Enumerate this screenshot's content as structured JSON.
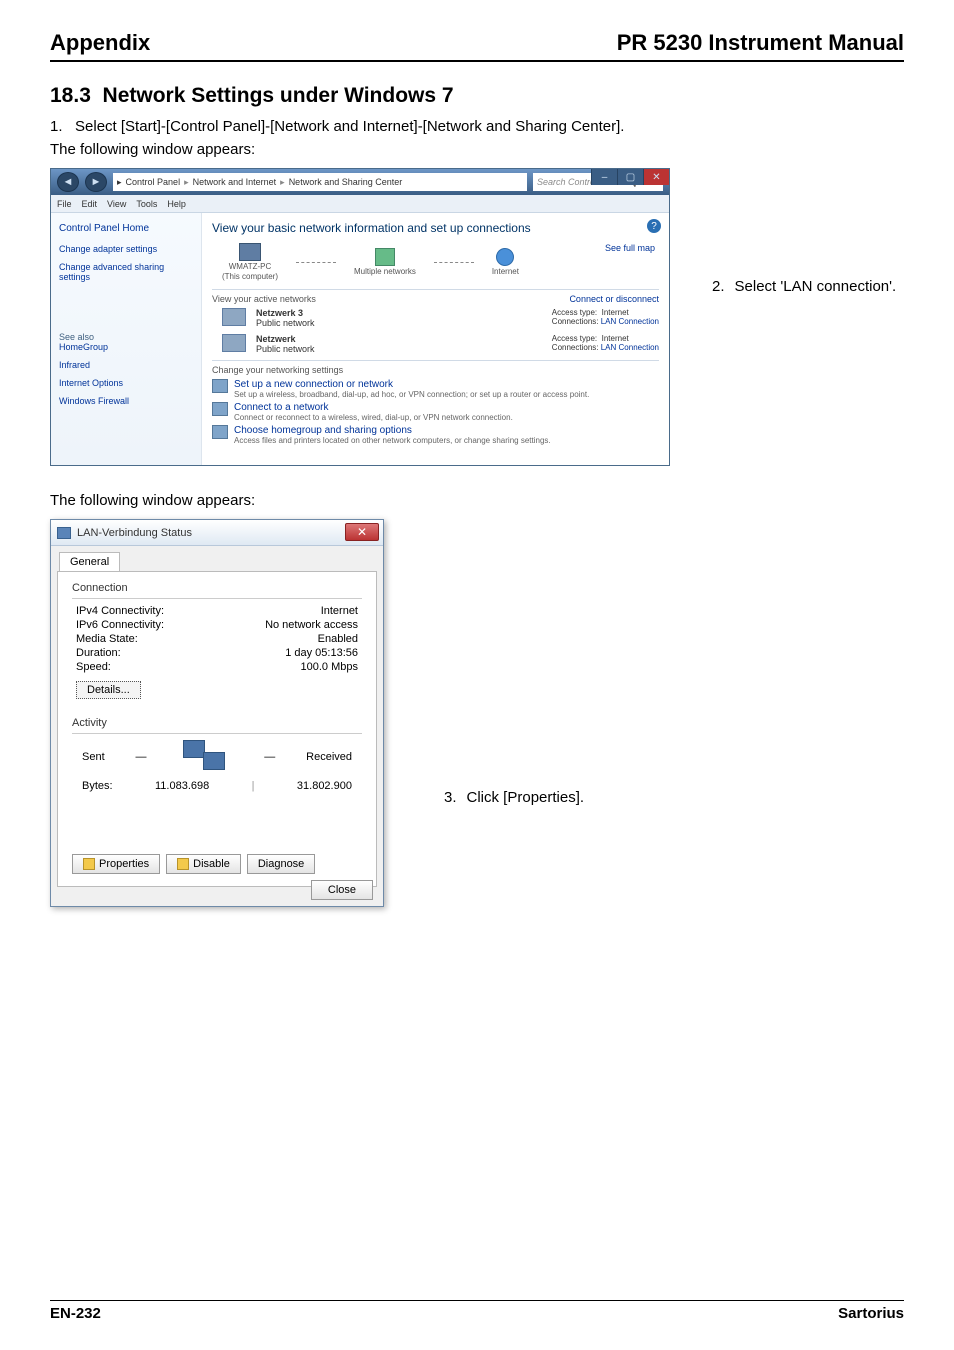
{
  "header": {
    "left": "Appendix",
    "right": "PR 5230 Instrument Manual"
  },
  "section": {
    "num": "18.3",
    "title": "Network Settings under Windows 7"
  },
  "step1": {
    "n": "1.",
    "text": "Select [Start]-[Control Panel]-[Network and Internet]-[Network and Sharing Center]."
  },
  "following": "The following window appears:",
  "sideA": {
    "n": "2.",
    "text": "Select 'LAN connection'."
  },
  "sideB": {
    "n": "3.",
    "text": "Click [Properties]."
  },
  "footer": {
    "left": "EN-232",
    "right": "Sartorius"
  },
  "shot1": {
    "breadcrumb": {
      "a": "Control Panel",
      "b": "Network and Internet",
      "c": "Network and Sharing Center"
    },
    "search_placeholder": "Search Control Panel",
    "menubar": [
      "File",
      "Edit",
      "View",
      "Tools",
      "Help"
    ],
    "left": {
      "home": "Control Panel Home",
      "l1": "Change adapter settings",
      "l2": "Change advanced sharing settings",
      "see": "See also",
      "s1": "HomeGroup",
      "s2": "Infrared",
      "s3": "Internet Options",
      "s4": "Windows Firewall"
    },
    "main_title": "View your basic network information and set up connections",
    "see_full_map": "See full map",
    "node1a": "WMATZ-PC",
    "node1b": "(This computer)",
    "node2": "Multiple networks",
    "node3": "Internet",
    "active_hdr": "View your active networks",
    "active_right": "Connect or disconnect",
    "net1_name": "Netzwerk 3",
    "net1_type": "Public network",
    "net2_name": "Netzwerk",
    "net2_type": "Public network",
    "conn_lbl_access": "Access type:",
    "conn_lbl_conn": "Connections:",
    "conn_val_access": "Internet",
    "conn_val_conn": "LAN Connection",
    "change_hdr": "Change your networking settings",
    "task1a": "Set up a new connection or network",
    "task1b": "Set up a wireless, broadband, dial-up, ad hoc, or VPN connection; or set up a router or access point.",
    "task2a": "Connect to a network",
    "task2b": "Connect or reconnect to a wireless, wired, dial-up, or VPN network connection.",
    "task3a": "Choose homegroup and sharing options",
    "task3b": "Access files and printers located on other network computers, or change sharing settings."
  },
  "shot2": {
    "title": "LAN-Verbindung Status",
    "tab": "General",
    "grp_conn": "Connection",
    "grp_act": "Activity",
    "kv": {
      "k1": "IPv4 Connectivity:",
      "v1": "Internet",
      "k2": "IPv6 Connectivity:",
      "v2": "No network access",
      "k3": "Media State:",
      "v3": "Enabled",
      "k4": "Duration:",
      "v4": "1 day 05:13:56",
      "k5": "Speed:",
      "v5": "100.0 Mbps"
    },
    "details_btn": "Details...",
    "sent": "Sent",
    "recv": "Received",
    "bytes_lbl": "Bytes:",
    "bytes_sent": "11.083.698",
    "bytes_recv": "31.802.900",
    "btn_props": "Properties",
    "btn_disable": "Disable",
    "btn_diag": "Diagnose",
    "btn_close": "Close"
  }
}
